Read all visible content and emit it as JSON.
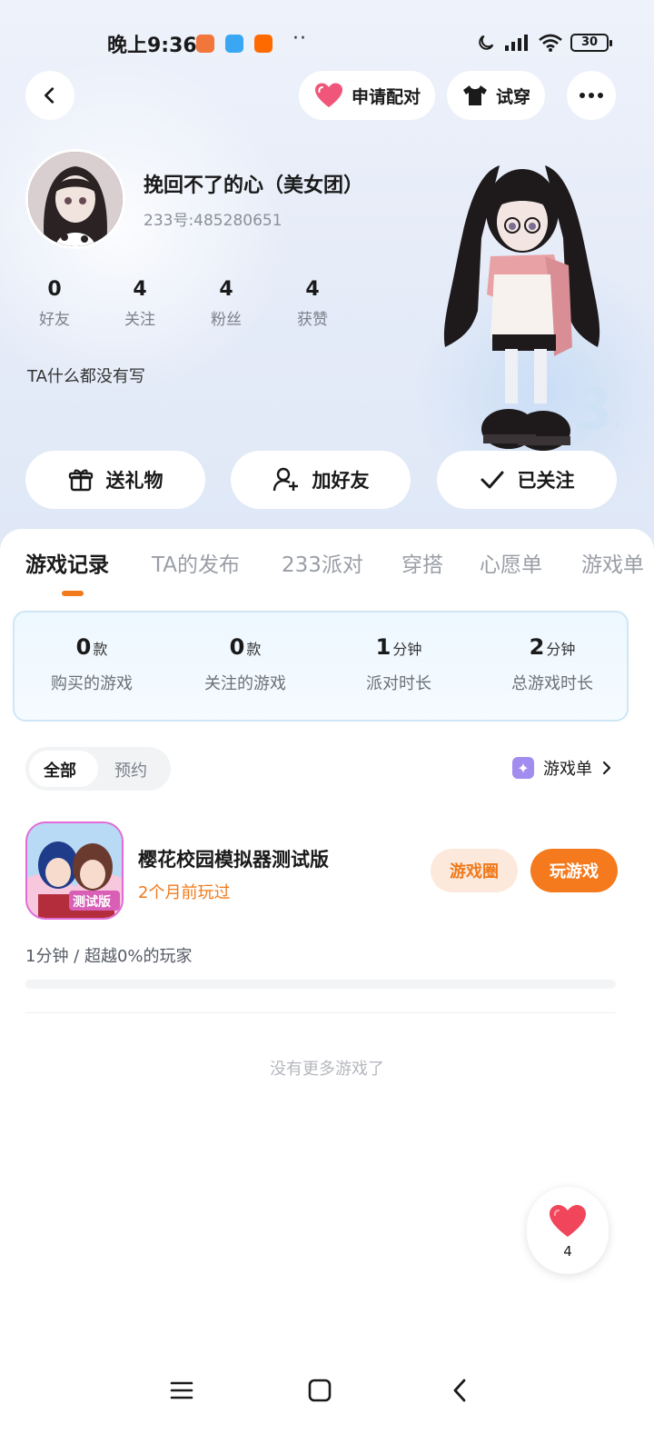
{
  "status_bar": {
    "time": "晚上9:36",
    "dots": "··",
    "battery": "30",
    "app_icons": [
      "taobao-icon",
      "cloud-icon",
      "mi-icon"
    ]
  },
  "header": {
    "match_label": "申请配对",
    "tryon_label": "试穿"
  },
  "profile": {
    "name": "挽回不了的心（美女团）",
    "uid": "233号:485280651",
    "stats": [
      {
        "num": "0",
        "label": "好友"
      },
      {
        "num": "4",
        "label": "关注"
      },
      {
        "num": "4",
        "label": "粉丝"
      },
      {
        "num": "4",
        "label": "获赞"
      }
    ],
    "bio": "TA什么都没有写"
  },
  "actions": {
    "gift": "送礼物",
    "add_friend": "加好友",
    "following": "已关注"
  },
  "tabs": [
    "游戏记录",
    "TA的发布",
    "233派对",
    "穿搭",
    "心愿单",
    "游戏单"
  ],
  "summary": [
    {
      "num": "0",
      "unit": "款",
      "label": "购买的游戏"
    },
    {
      "num": "0",
      "unit": "款",
      "label": "关注的游戏"
    },
    {
      "num": "1",
      "unit": "分钟",
      "label": "派对时长"
    },
    {
      "num": "2",
      "unit": "分钟",
      "label": "总游戏时长"
    }
  ],
  "filter": {
    "all": "全部",
    "reserve": "预约"
  },
  "gamelist_link": "游戏单",
  "game": {
    "title": "樱花校园模拟器测试版",
    "subtitle": "2个月前玩过",
    "circle_btn": "游戏圈",
    "play_btn": "玩游戏",
    "playtime": "1分钟 / 超越0%的玩家",
    "progress": 0
  },
  "no_more": "没有更多游戏了",
  "likes": "4",
  "colors": {
    "accent": "#f07a1c",
    "heart": "#f0455a"
  }
}
